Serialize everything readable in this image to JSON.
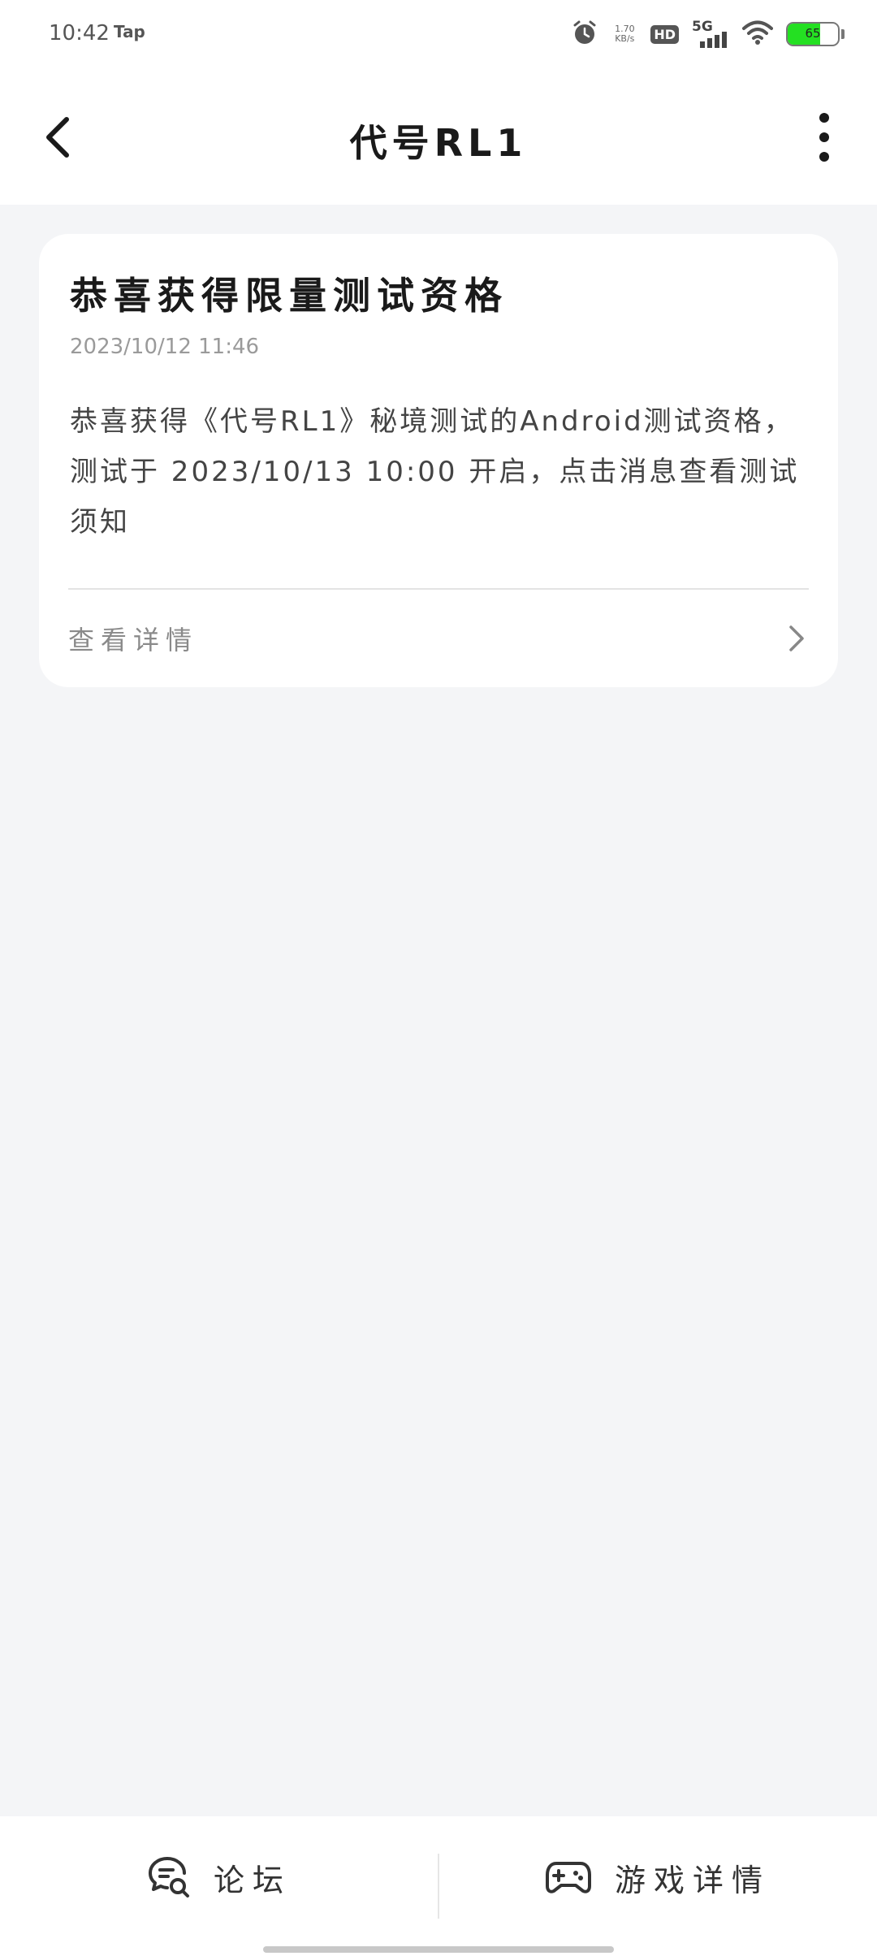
{
  "status_bar": {
    "time": "10:42",
    "app": "Tap",
    "net_speed_value": "1.70",
    "net_speed_unit": "KB/s",
    "hd": "HD",
    "network": "5G",
    "battery": "65",
    "battery_level_percent": 65,
    "battery_color": "#24e022"
  },
  "nav": {
    "title": "代号RL1",
    "back_icon": "chevron-left-icon",
    "more_icon": "more-vertical-icon"
  },
  "message": {
    "title": "恭喜获得限量测试资格",
    "time": "2023/10/12 11:46",
    "body": "恭喜获得《代号RL1》秘境测试的Android测试资格，测试于 2023/10/13 10:00 开启，点击消息查看测试须知",
    "link_label": "查看详情"
  },
  "bottom_tabs": [
    {
      "label": "论坛",
      "icon": "forum-chat-icon"
    },
    {
      "label": "游戏详情",
      "icon": "gamepad-icon"
    }
  ]
}
